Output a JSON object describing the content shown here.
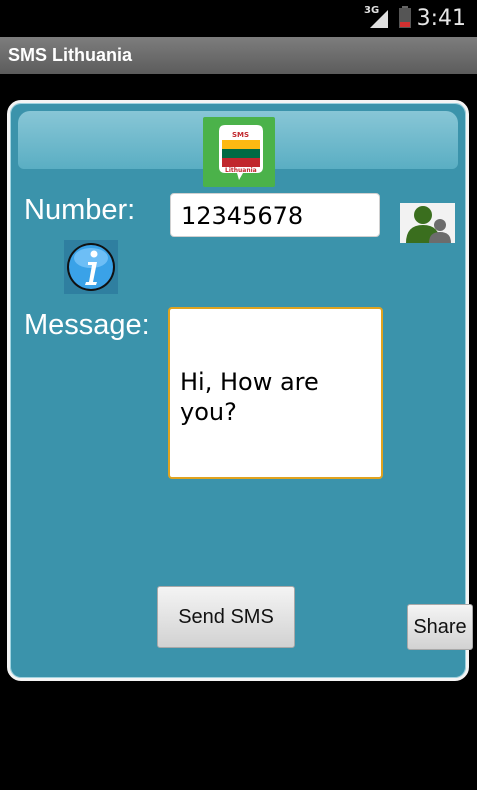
{
  "status_bar": {
    "network_type": "3G",
    "time": "3:41",
    "icons": [
      "signal-icon",
      "battery-icon"
    ]
  },
  "app": {
    "title": "SMS Lithuania"
  },
  "logo": {
    "top_text": "SMS",
    "bottom_text": "Lithuania",
    "flag_colors": [
      "#fdb913",
      "#006a44",
      "#c1272d"
    ]
  },
  "form": {
    "number_label": "Number:",
    "number_value": "12345678",
    "message_label": "Message:",
    "message_value": "Hi, How are you?"
  },
  "buttons": {
    "send_label": "Send SMS",
    "share_label": "Share"
  },
  "icons": {
    "contact": "contacts-icon",
    "info": "info-icon"
  },
  "colors": {
    "panel": "#3b93ab",
    "accent_border": "#e0a31f"
  }
}
